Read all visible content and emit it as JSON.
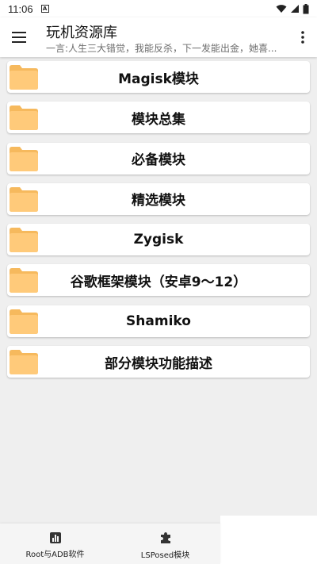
{
  "status_bar": {
    "time": "11:06",
    "badge": "A"
  },
  "app_bar": {
    "title": "玩机资源库",
    "subtitle": "一言:人生三大错觉，我能反杀，下一发能出金，她喜..."
  },
  "list_items": [
    {
      "label": "Magisk模块"
    },
    {
      "label": "模块总集"
    },
    {
      "label": "必备模块"
    },
    {
      "label": "精选模块"
    },
    {
      "label": "Zygisk"
    },
    {
      "label": "谷歌框架模块（安卓9～12）"
    },
    {
      "label": "Shamiko"
    },
    {
      "label": "部分模块功能描述"
    }
  ],
  "bottom_nav": [
    {
      "label": "Root与ADB软件",
      "icon": "chart-icon"
    },
    {
      "label": "LSPosed模块",
      "icon": "puzzle-icon"
    }
  ],
  "colors": {
    "folder": "#ffca7a",
    "folder_dark": "#f6b95d",
    "card": "#ffffff",
    "background": "#efefef"
  }
}
